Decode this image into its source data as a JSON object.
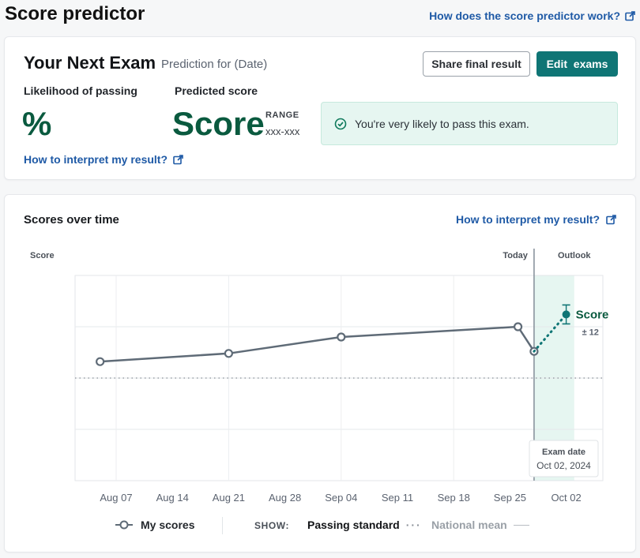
{
  "header": {
    "title": "Score predictor",
    "help_link": "How does the score predictor work?"
  },
  "summary": {
    "exam_title": "Your Next Exam",
    "prediction_for": "Prediction for (Date)",
    "share_button": "Share final result",
    "edit_button": "Edit  exams",
    "likelihood_label": "Likelihood of passing",
    "likelihood_value": "%",
    "predicted_label": "Predicted score",
    "predicted_value": "Score",
    "range_label": "RANGE",
    "range_value": "xxx-xxx",
    "alert_text": "You're very likely to pass this exam.",
    "interpret_link": "How to interpret my result?",
    "accent_color": "#0f7575",
    "score_color": "#0a5a3f"
  },
  "chart_section": {
    "title": "Scores over time",
    "interpret_link": "How to interpret my result?",
    "y_label": "Score",
    "today_label": "Today",
    "outlook_label": "Outlook",
    "projection_label": "Score",
    "projection_margin": "± 12",
    "exam_date_label": "Exam date",
    "exam_date_value": "Oct 02, 2024",
    "legend": {
      "my_scores": "My scores",
      "show_label": "SHOW:",
      "passing_standard": "Passing standard",
      "national_mean": "National mean"
    }
  },
  "chart_data": {
    "type": "line",
    "x_ticks": [
      "Aug 07",
      "Aug 14",
      "Aug 21",
      "Aug 28",
      "Sep 04",
      "Sep 11",
      "Sep 18",
      "Sep 25",
      "Oct 02"
    ],
    "series": [
      {
        "name": "My scores",
        "points": [
          {
            "x": "2024-08-05",
            "y": 0.58
          },
          {
            "x": "2024-08-21",
            "y": 0.62
          },
          {
            "x": "2024-09-04",
            "y": 0.7
          },
          {
            "x": "2024-09-26",
            "y": 0.75
          },
          {
            "x": "2024-09-28",
            "y": 0.63
          }
        ]
      }
    ],
    "projection": {
      "x": "2024-10-02",
      "y": 0.81,
      "margin": 12
    },
    "passing_standard": 0.5,
    "today": "2024-09-28",
    "outlook_end": "2024-10-03",
    "y_ticks": 4,
    "grid": true,
    "line_color": "#5f6b77",
    "projection_color": "#0f7575",
    "outlook_fill": "#e6f6f1"
  }
}
